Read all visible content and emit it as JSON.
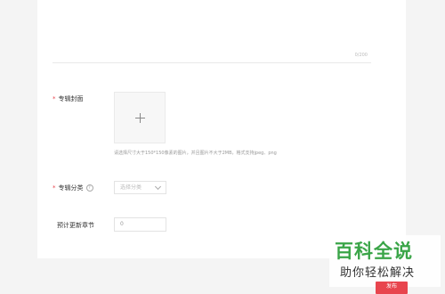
{
  "description": {
    "counter": "0/200"
  },
  "cover": {
    "label": "专辑封面",
    "hint": "请选择尺寸大于150*150像素的图片，并且图片不大于2MB，格式支持jpeg、png"
  },
  "category": {
    "label": "专辑分类",
    "help_icon": "?",
    "placeholder": "选择分类"
  },
  "chapters": {
    "label": "预计更新章节",
    "value": "0"
  },
  "footer": {
    "publish_label": "发布"
  },
  "watermark": {
    "title": "百科全说",
    "subtitle": "助你轻松解决"
  },
  "colors": {
    "required": "#e8454e",
    "publish_bg": "#e8454e",
    "watermark_green": "#3aa548"
  },
  "icons": {
    "upload": "plus-icon",
    "dropdown": "chevron-down-icon",
    "help": "question-circle-icon"
  }
}
